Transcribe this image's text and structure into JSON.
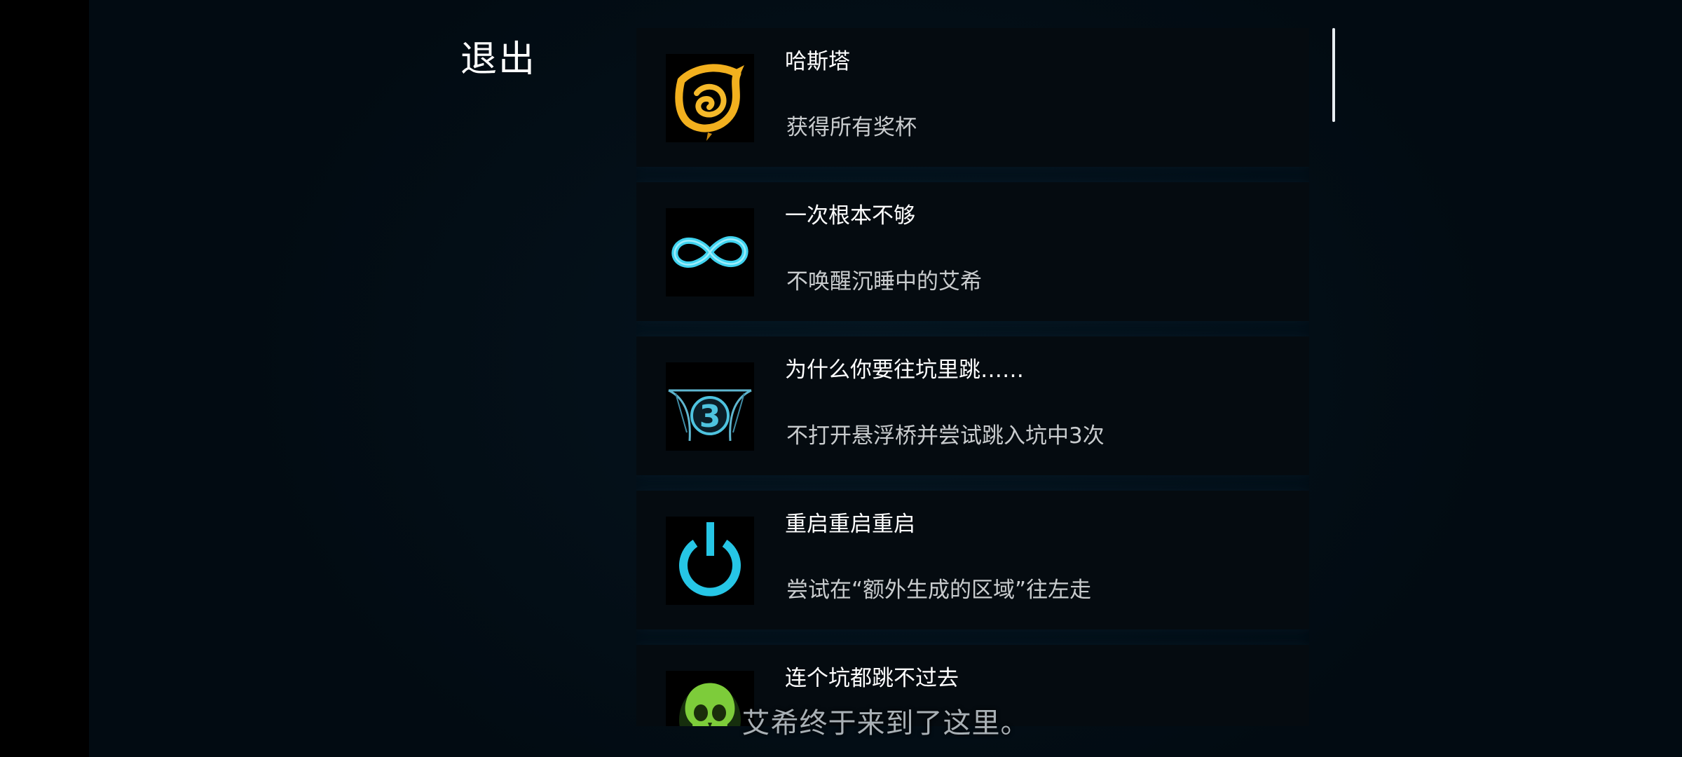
{
  "menu": {
    "exit_label": "退出"
  },
  "achievements": [
    {
      "title": "哈斯塔",
      "description": "获得所有奖杯",
      "icon": "golden-swirl-icon",
      "icon_color": "#f2b01e"
    },
    {
      "title": "一次根本不够",
      "description": "不唤醒沉睡中的艾希",
      "icon": "infinity-icon",
      "icon_color": "#3fd3ef"
    },
    {
      "title": "为什么你要往坑里跳……",
      "description": "不打开悬浮桥并尝试跳入坑中3次",
      "icon": "pit-3-icon",
      "icon_text": "3",
      "icon_color": "#4ec3df"
    },
    {
      "title": "重启重启重启",
      "description": "尝试在“额外生成的区域”往左走",
      "icon": "power-icon",
      "icon_color": "#26c6e6"
    },
    {
      "title": "连个坑都跳不过去",
      "description": "",
      "icon": "green-skull-icon",
      "icon_color": "#7dcc3a"
    }
  ],
  "subtitle": "艾希终于来到了这里。",
  "colors": {
    "background": "#041019",
    "card": "#050b10",
    "title_text": "#ffffff",
    "description_text": "#c9ccce",
    "subtitle_text": "#a9b0b5"
  }
}
